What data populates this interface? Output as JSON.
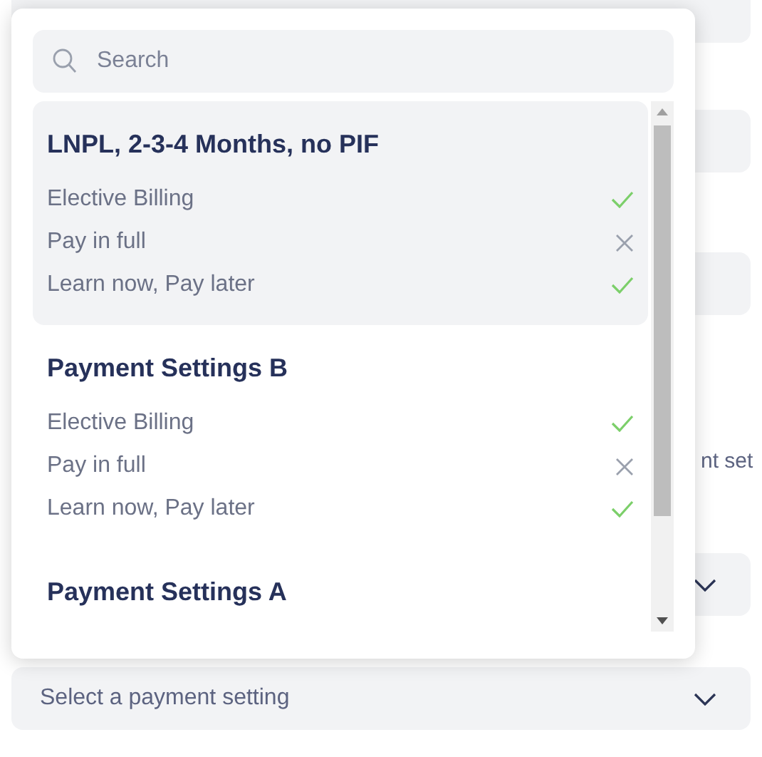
{
  "background": {
    "partial_label": "nt set",
    "select": {
      "placeholder": "Select a payment setting"
    }
  },
  "dropdown": {
    "search": {
      "placeholder": "Search"
    },
    "groups": [
      {
        "title": "LNPL, 2-3-4 Months, no PIF",
        "selected": true,
        "options": [
          {
            "label": "Elective Billing",
            "enabled": true
          },
          {
            "label": "Pay in full",
            "enabled": false
          },
          {
            "label": "Learn now, Pay later",
            "enabled": true
          }
        ]
      },
      {
        "title": "Payment Settings B",
        "selected": false,
        "options": [
          {
            "label": "Elective Billing",
            "enabled": true
          },
          {
            "label": "Pay in full",
            "enabled": false
          },
          {
            "label": "Learn now, Pay later",
            "enabled": true
          }
        ]
      },
      {
        "title": "Payment Settings A",
        "selected": false
      }
    ]
  }
}
